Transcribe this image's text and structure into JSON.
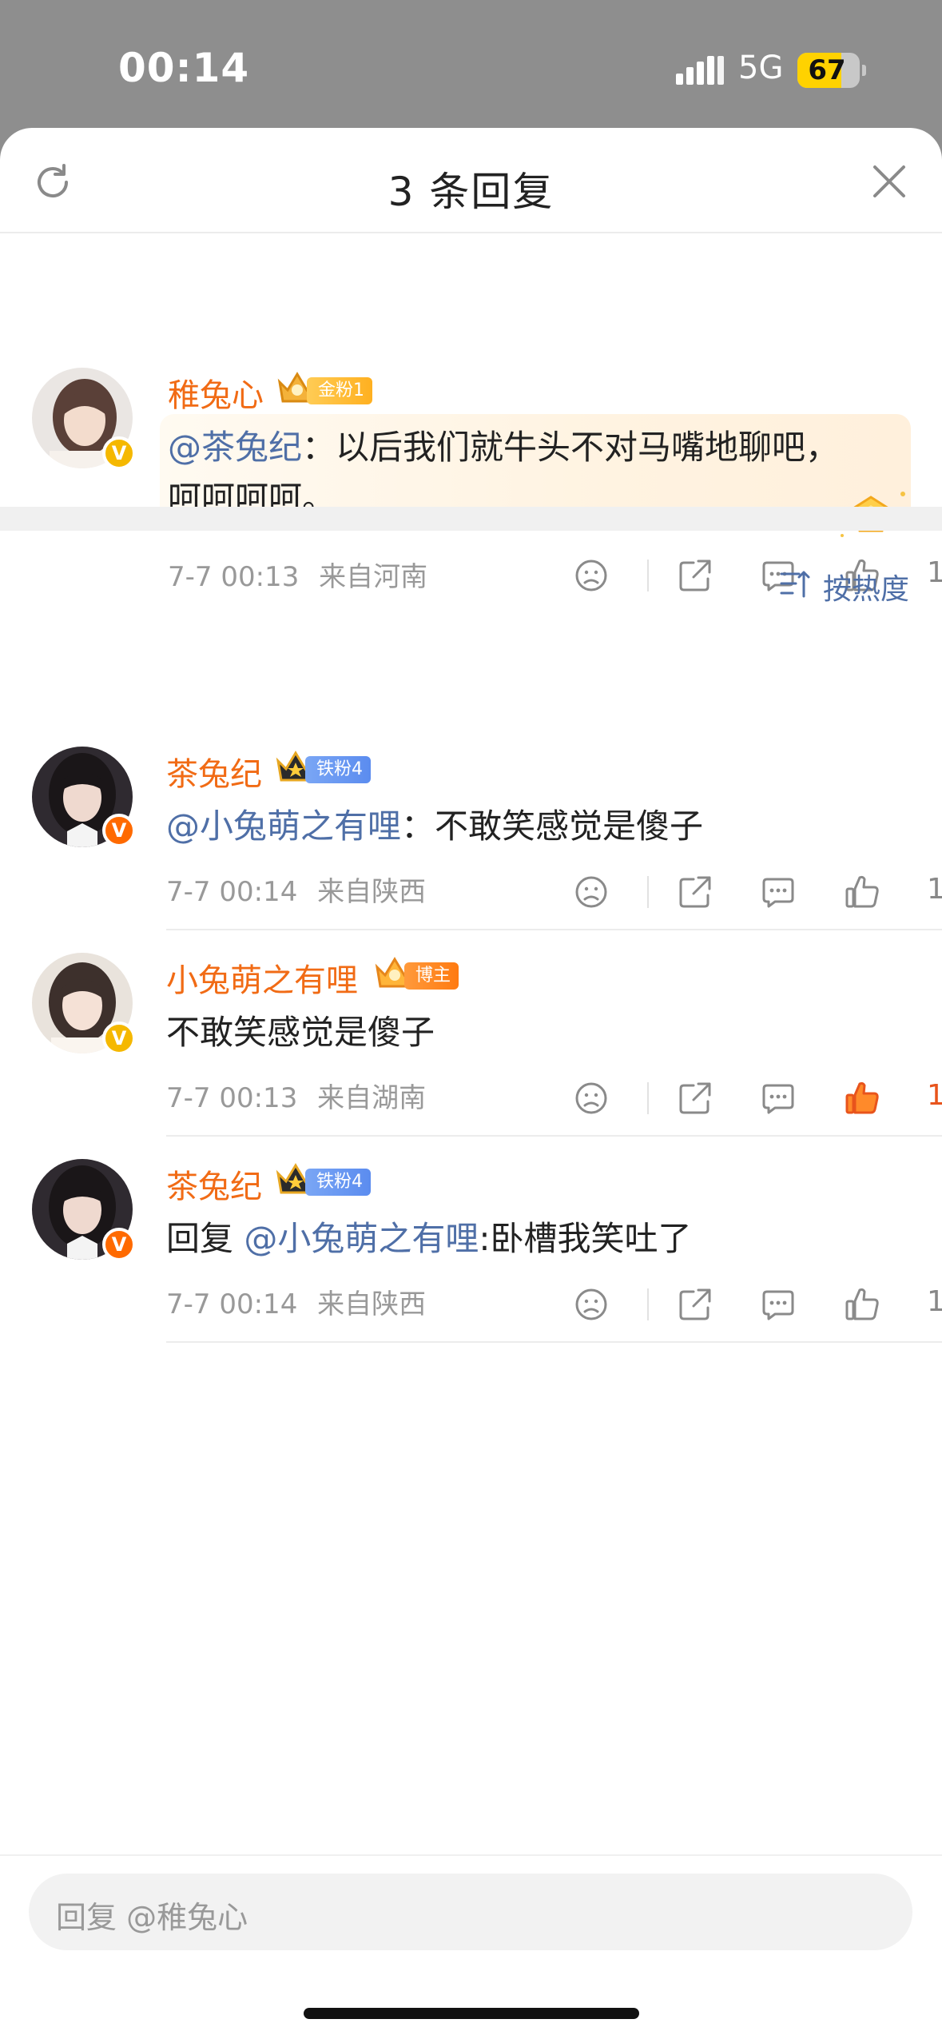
{
  "status_bar": {
    "time": "00:14",
    "network": "5G",
    "battery": "67"
  },
  "header": {
    "title": "3 条回复"
  },
  "root_comment": {
    "username": "稚兔心",
    "fan_badge": "金粉1",
    "mention": "@茶兔纪",
    "text_line1": "：以后我们就牛头不对马嘴地聊吧，",
    "text_line2": "呵呵呵呵。",
    "date": "7-7 00:13",
    "location": "来自河南",
    "likes": "1"
  },
  "sort": {
    "label": "按热度"
  },
  "replies": [
    {
      "username": "茶兔纪",
      "fan_badge": "铁粉4",
      "mention": "@小兔萌之有哩",
      "text": "：不敢笑感觉是傻子",
      "date": "7-7 00:14",
      "location": "来自陕西",
      "likes": "1"
    },
    {
      "username": "小兔萌之有哩",
      "fan_badge": "博主",
      "text": "不敢笑感觉是傻子",
      "date": "7-7 00:13",
      "location": "来自湖南",
      "likes": "1"
    },
    {
      "username": "茶兔纪",
      "fan_badge": "铁粉4",
      "prefix": "回复 ",
      "mention": "@小兔萌之有哩",
      "text": ":卧槽我笑吐了",
      "date": "7-7 00:14",
      "location": "来自陕西",
      "likes": "1"
    }
  ],
  "composer": {
    "placeholder": "回复 @稚兔心"
  },
  "colors": {
    "username": "#f16b15",
    "mention": "#4f6fa7",
    "liked": "#e8541c"
  }
}
